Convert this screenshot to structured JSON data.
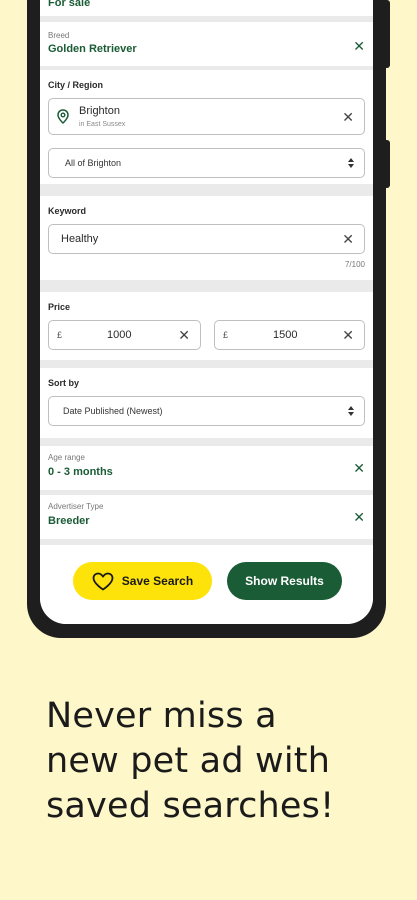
{
  "top": {
    "partial_label": "For sale"
  },
  "breed": {
    "label": "Breed",
    "value": "Golden Retriever",
    "clear_icon": "close-icon"
  },
  "city": {
    "label": "City / Region",
    "value": "Brighton",
    "sub": "in East Sussex",
    "area_select": "All of Brighton",
    "pin_icon": "location-pin-icon"
  },
  "keyword": {
    "label": "Keyword",
    "value": "Healthy",
    "counter": "7/100"
  },
  "price": {
    "label": "Price",
    "currency": "£",
    "min": "1000",
    "max": "1500"
  },
  "sort": {
    "label": "Sort by",
    "value": "Date Published (Newest)"
  },
  "age": {
    "label": "Age range",
    "value": "0 - 3 months"
  },
  "advertiser": {
    "label": "Advertiser Type",
    "value": "Breeder"
  },
  "actions": {
    "save_label": "Save Search",
    "show_label": "Show Results",
    "heart_icon": "heart-icon"
  },
  "tagline": {
    "line1": "Never miss a",
    "line2": "new pet ad with",
    "line3": "saved searches!"
  },
  "colors": {
    "background": "#fdf7c9",
    "brand_green": "#1a5c36",
    "brand_yellow": "#fde30a",
    "phone_frame": "#1e1e1e"
  }
}
